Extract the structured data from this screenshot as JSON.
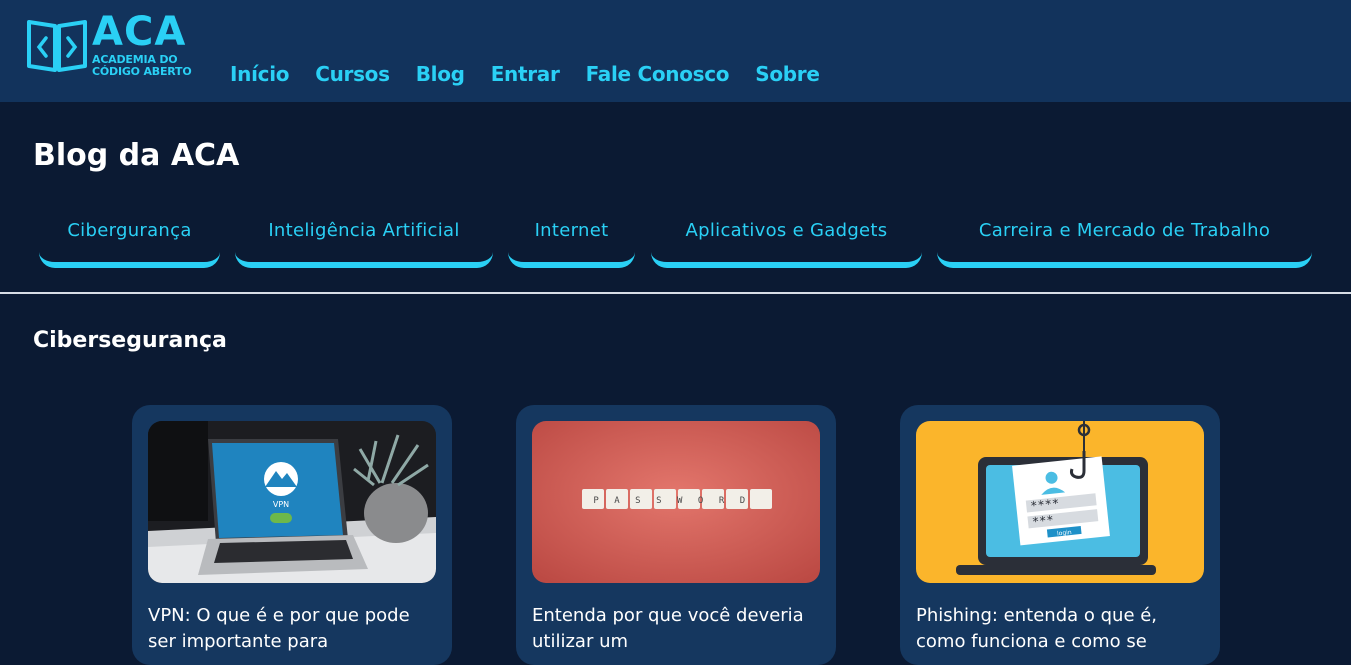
{
  "brand": {
    "name": "ACA",
    "sub_line1": "ACADEMIA DO",
    "sub_line2": "CÓDIGO ABERTO",
    "color": "#2ad0f5"
  },
  "nav": {
    "items": [
      "Início",
      "Cursos",
      "Blog",
      "Entrar",
      "Fale Conosco",
      "Sobre"
    ]
  },
  "page": {
    "title": "Blog da ACA"
  },
  "categories": [
    "Cibergurança",
    "Inteligência Artificial",
    "Internet",
    "Aplicativos e Gadgets",
    "Carreira e Mercado de Trabalho"
  ],
  "section": {
    "title": "Cibersegurança"
  },
  "cards": [
    {
      "title": "VPN: O que é e por que pode ser importante para",
      "image": "laptop-vpn-photo",
      "image_text": "VPN"
    },
    {
      "title": "Entenda por que você deveria utilizar um",
      "image": "password-tiles-photo",
      "image_text": "PASSWORD"
    },
    {
      "title": "Phishing: entenda o que é, como funciona e como se",
      "image": "phishing-illustration",
      "image_text": "login"
    }
  ],
  "colors": {
    "header_bg": "#12335c",
    "page_bg": "#0b1a33",
    "card_bg": "#15375f",
    "accent": "#2ad0f5"
  }
}
